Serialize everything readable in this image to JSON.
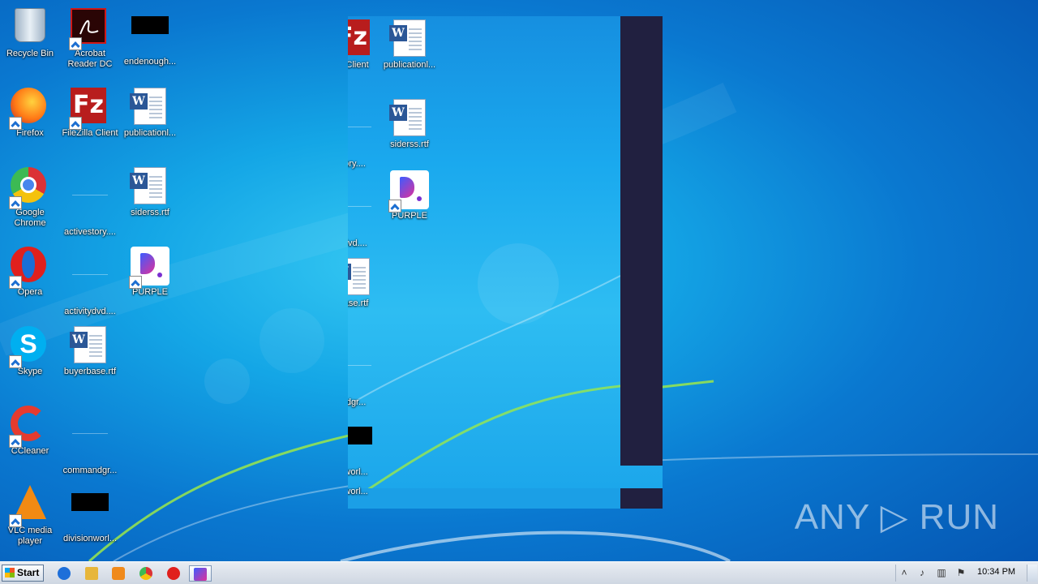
{
  "desktop": {
    "icons": [
      {
        "label": "Recycle Bin",
        "icon": "recycle-bin-icon"
      },
      {
        "label": "Acrobat Reader DC",
        "icon": "acrobat-reader-icon"
      },
      {
        "label": "endenough...",
        "icon": "redacted-file-icon"
      },
      {
        "label": "Firefox",
        "icon": "firefox-icon"
      },
      {
        "label": "FileZilla Client",
        "icon": "filezilla-icon"
      },
      {
        "label": "publicationl...",
        "icon": "word-document-icon"
      },
      {
        "label": "Google Chrome",
        "icon": "chrome-icon"
      },
      {
        "label": "activestory....",
        "icon": "blank-file-icon"
      },
      {
        "label": "siderss.rtf",
        "icon": "word-document-icon"
      },
      {
        "label": "Opera",
        "icon": "opera-icon"
      },
      {
        "label": "activitydvd....",
        "icon": "blank-file-icon"
      },
      {
        "label": "PURPLE",
        "icon": "purple-app-icon"
      },
      {
        "label": "Skype",
        "icon": "skype-icon"
      },
      {
        "label": "buyerbase.rtf",
        "icon": "word-document-icon"
      },
      {
        "label": "CCleaner",
        "icon": "ccleaner-icon"
      },
      {
        "label": "commandgr...",
        "icon": "blank-file-icon"
      },
      {
        "label": "VLC media player",
        "icon": "vlc-icon"
      },
      {
        "label": "divisionworl...",
        "icon": "redacted-file-icon"
      }
    ]
  },
  "ghost_window": {
    "icons": [
      {
        "label": "a Client"
      },
      {
        "label": "publicationl..."
      },
      {
        "label": "tory...."
      },
      {
        "label": "siderss.rtf"
      },
      {
        "label": "rdvd...."
      },
      {
        "label": "PURPLE"
      },
      {
        "label": "base.rtf"
      },
      {
        "label": "ndgr..."
      },
      {
        "label": "nworl..."
      },
      {
        "label": "nworl..."
      }
    ]
  },
  "watermark": {
    "text": "ANY ▷ RUN"
  },
  "taskbar": {
    "start_label": "Start",
    "clock": "10:34 PM",
    "pinned": [
      {
        "name": "internet-explorer-icon",
        "color": "#1e6fd9"
      },
      {
        "name": "file-explorer-icon",
        "color": "#e7b63a"
      },
      {
        "name": "media-player-icon",
        "color": "#f08a1c"
      },
      {
        "name": "chrome-icon",
        "color": "#3cba54"
      },
      {
        "name": "opera-icon",
        "color": "#e0201d"
      },
      {
        "name": "purple-app-icon",
        "color": "#7a2fd0"
      }
    ],
    "tray_icons": [
      "show-hidden-icons-icon",
      "volume-icon",
      "network-icon",
      "action-center-flag-icon"
    ]
  }
}
